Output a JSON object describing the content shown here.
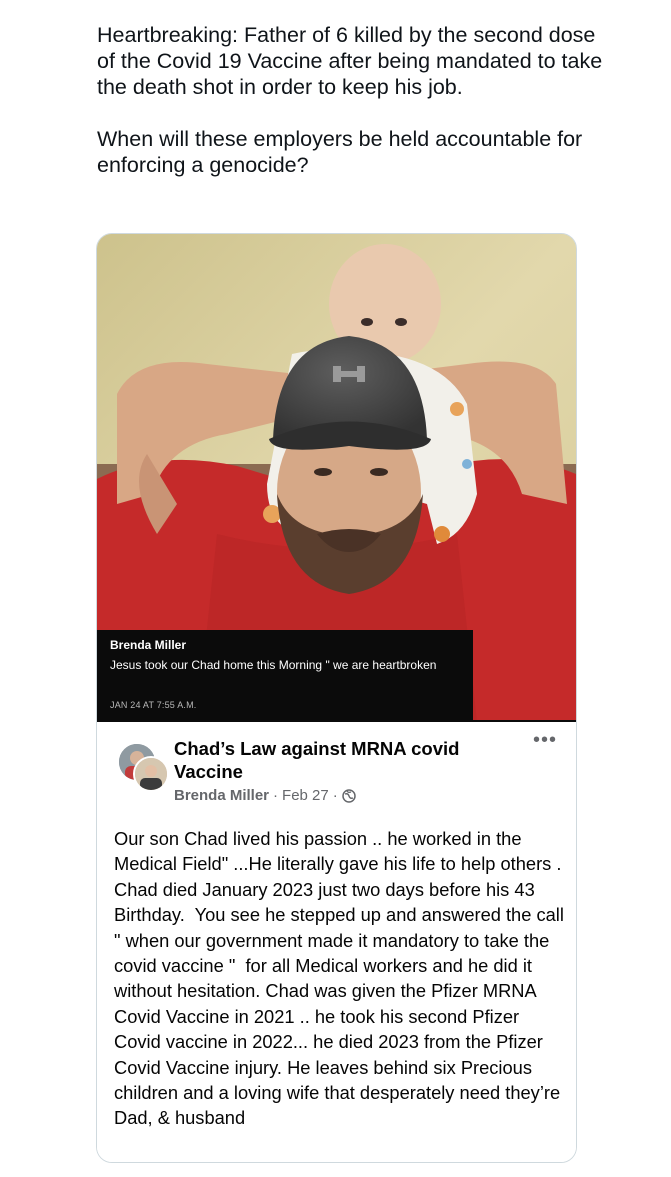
{
  "tweet": {
    "text": "Heartbreaking: Father of 6 killed by the second dose of the Covid 19 Vaccine after being mandated to take the death shot in order to keep his job.\n\nWhen will these employers be held accountable for enforcing a genocide?"
  },
  "photo": {
    "caption_name": "Brenda Miller",
    "caption_text": "Jesus took our Chad home this Morning \" we are heartbroken",
    "caption_time": "JAN 24 AT 7:55 A.M.",
    "colors": {
      "wall": "#d9cf9e",
      "shirt": "#c52a2a",
      "cap": "#4a4a4a"
    }
  },
  "fb_post": {
    "group_name": "Chad’s Law against MRNA covid Vaccine",
    "author": "Brenda Miller",
    "date": "Feb 27",
    "separator": "·",
    "more_label": "•••",
    "body": "Our son Chad lived his passion .. he worked in the Medical Field\" ...He literally gave his life to help others . Chad died January 2023 just two days before his 43 Birthday.  You see he stepped up and answered the call \" when our government made it mandatory to take the covid vaccine \"  for all Medical workers and he did it without hesitation. Chad was given the Pfizer MRNA Covid Vaccine in 2021 .. he took his second Pfizer Covid vaccine in 2022... he died 2023 from the Pfizer Covid Vaccine injury. He leaves behind six Precious children and a loving wife that desperately need they’re Dad, & husband",
    "icons": {
      "privacy": "globe-icon",
      "menu": "more-options-icon"
    }
  }
}
